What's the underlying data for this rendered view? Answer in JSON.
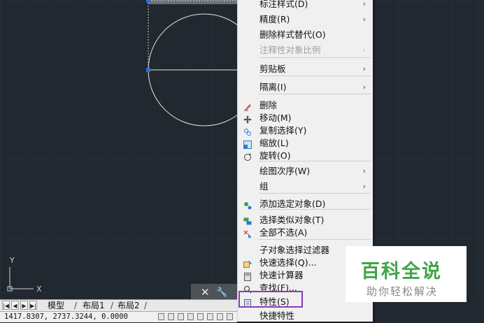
{
  "context_menu": {
    "items": [
      {
        "label": "标注样式(D)",
        "submenu": true,
        "enabled": true,
        "icon": null
      },
      {
        "label": "精度(R)",
        "submenu": true,
        "enabled": true,
        "icon": null
      },
      {
        "label": "删除样式替代(O)",
        "submenu": false,
        "enabled": true,
        "icon": null
      },
      {
        "label": "注释性对象比例",
        "submenu": true,
        "enabled": false,
        "icon": null
      },
      {
        "label": "剪贴板",
        "submenu": true,
        "enabled": true,
        "icon": null
      },
      {
        "label": "隔离(I)",
        "submenu": true,
        "enabled": true,
        "icon": null
      },
      {
        "label": "删除",
        "submenu": false,
        "enabled": true,
        "icon": "eraser-icon"
      },
      {
        "label": "移动(M)",
        "submenu": false,
        "enabled": true,
        "icon": "move-icon"
      },
      {
        "label": "复制选择(Y)",
        "submenu": false,
        "enabled": true,
        "icon": "copy-icon"
      },
      {
        "label": "缩放(L)",
        "submenu": false,
        "enabled": true,
        "icon": "scale-icon"
      },
      {
        "label": "旋转(O)",
        "submenu": false,
        "enabled": true,
        "icon": "rotate-icon"
      },
      {
        "label": "绘图次序(W)",
        "submenu": true,
        "enabled": true,
        "icon": null
      },
      {
        "label": "组",
        "submenu": true,
        "enabled": true,
        "icon": null
      },
      {
        "label": "添加选定对象(D)",
        "submenu": false,
        "enabled": true,
        "icon": "add-selected-icon"
      },
      {
        "label": "选择类似对象(T)",
        "submenu": false,
        "enabled": true,
        "icon": "select-similar-icon"
      },
      {
        "label": "全部不选(A)",
        "submenu": false,
        "enabled": true,
        "icon": "deselect-all-icon"
      },
      {
        "label": "子对象选择过滤器",
        "submenu": true,
        "enabled": true,
        "icon": null
      },
      {
        "label": "快速选择(Q)...",
        "submenu": false,
        "enabled": true,
        "icon": "quick-select-icon"
      },
      {
        "label": "快速计算器",
        "submenu": false,
        "enabled": true,
        "icon": "calculator-icon"
      },
      {
        "label": "查找(F)...",
        "submenu": false,
        "enabled": true,
        "icon": "find-icon"
      },
      {
        "label": "特性(S)",
        "submenu": false,
        "enabled": true,
        "icon": "properties-icon"
      },
      {
        "label": "快捷特性",
        "submenu": false,
        "enabled": true,
        "icon": null
      }
    ]
  },
  "layout_tabs": [
    "模型",
    "布局1",
    "布局2"
  ],
  "tab_nav": [
    "|◀",
    "◀",
    "▶",
    "▶|"
  ],
  "status": {
    "coordinates": "1417.8307, 2737.3244, 0.0000"
  },
  "ucs": {
    "x_label": "X",
    "y_label": "Y"
  },
  "watermark": {
    "title": "百科全说",
    "subtitle": "助你轻松解决"
  },
  "command_bar": {
    "close": "✕",
    "customize": "🔧"
  },
  "colors": {
    "canvas": "#212830",
    "accent_highlight": "#8a3ab9",
    "watermark_green": "#3fa447",
    "grip": "#2a6fdb"
  }
}
